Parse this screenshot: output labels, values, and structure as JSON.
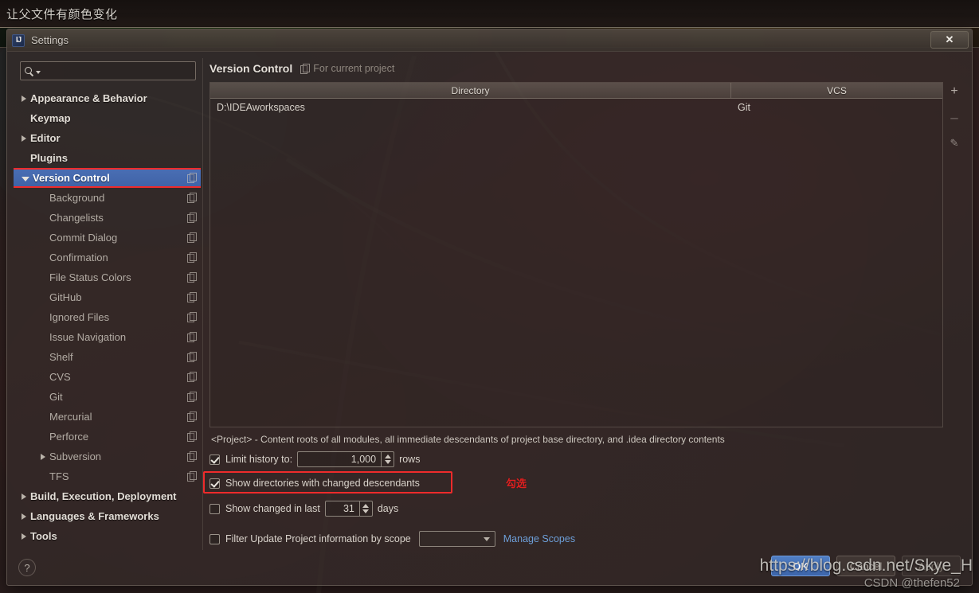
{
  "desktop": {
    "caption": "让父文件有颜色变化"
  },
  "window": {
    "title": "Settings",
    "app_icon": "intellij-idea-icon",
    "close_label": "✕"
  },
  "search": {
    "value": "",
    "placeholder": "",
    "icon": "search-icon"
  },
  "sidebar": {
    "items": [
      {
        "label": "Appearance & Behavior",
        "level": "top",
        "arrow": "collapsed",
        "copy": false,
        "selected": false
      },
      {
        "label": "Keymap",
        "level": "top",
        "arrow": "none",
        "copy": false,
        "selected": false
      },
      {
        "label": "Editor",
        "level": "top",
        "arrow": "collapsed",
        "copy": false,
        "selected": false
      },
      {
        "label": "Plugins",
        "level": "top",
        "arrow": "none",
        "copy": false,
        "selected": false
      },
      {
        "label": "Version Control",
        "level": "top",
        "arrow": "expanded",
        "copy": true,
        "selected": true
      },
      {
        "label": "Background",
        "level": "child",
        "arrow": "none",
        "copy": true,
        "selected": false
      },
      {
        "label": "Changelists",
        "level": "child",
        "arrow": "none",
        "copy": true,
        "selected": false
      },
      {
        "label": "Commit Dialog",
        "level": "child",
        "arrow": "none",
        "copy": true,
        "selected": false
      },
      {
        "label": "Confirmation",
        "level": "child",
        "arrow": "none",
        "copy": true,
        "selected": false
      },
      {
        "label": "File Status Colors",
        "level": "child",
        "arrow": "none",
        "copy": true,
        "selected": false
      },
      {
        "label": "GitHub",
        "level": "child",
        "arrow": "none",
        "copy": true,
        "selected": false
      },
      {
        "label": "Ignored Files",
        "level": "child",
        "arrow": "none",
        "copy": true,
        "selected": false
      },
      {
        "label": "Issue Navigation",
        "level": "child",
        "arrow": "none",
        "copy": true,
        "selected": false
      },
      {
        "label": "Shelf",
        "level": "child",
        "arrow": "none",
        "copy": true,
        "selected": false
      },
      {
        "label": "CVS",
        "level": "child",
        "arrow": "none",
        "copy": true,
        "selected": false
      },
      {
        "label": "Git",
        "level": "child",
        "arrow": "none",
        "copy": true,
        "selected": false
      },
      {
        "label": "Mercurial",
        "level": "child",
        "arrow": "none",
        "copy": true,
        "selected": false
      },
      {
        "label": "Perforce",
        "level": "child",
        "arrow": "none",
        "copy": true,
        "selected": false
      },
      {
        "label": "Subversion",
        "level": "child",
        "arrow": "collapsed",
        "copy": true,
        "selected": false
      },
      {
        "label": "TFS",
        "level": "child",
        "arrow": "none",
        "copy": true,
        "selected": false
      },
      {
        "label": "Build, Execution, Deployment",
        "level": "top",
        "arrow": "collapsed",
        "copy": false,
        "selected": false
      },
      {
        "label": "Languages & Frameworks",
        "level": "top",
        "arrow": "collapsed",
        "copy": false,
        "selected": false
      },
      {
        "label": "Tools",
        "level": "top",
        "arrow": "collapsed",
        "copy": false,
        "selected": false
      }
    ]
  },
  "panel": {
    "title": "Version Control",
    "scope_tag": "For current project",
    "scope_icon": "copy-icon"
  },
  "table": {
    "columns": [
      "Directory",
      "VCS"
    ],
    "rows": [
      {
        "directory": "D:\\IDEAworkspaces",
        "vcs": "Git"
      }
    ]
  },
  "toolbar": {
    "add_label": "+",
    "remove_label": "–",
    "edit_label": "✎",
    "add_icon": "plus-icon",
    "remove_icon": "minus-icon",
    "edit_icon": "pencil-icon"
  },
  "options": {
    "note": "<Project> - Content roots of all modules, all immediate descendants of project base directory, and .idea directory contents",
    "limit_history": {
      "label": "Limit history to:",
      "checked": true,
      "value": "1,000",
      "suffix": "rows"
    },
    "show_directories": {
      "label": "Show directories with changed descendants",
      "checked": true
    },
    "show_changed_last": {
      "label": "Show changed in last",
      "checked": false,
      "value": "31",
      "suffix": "days"
    },
    "filter_scope": {
      "label": "Filter Update Project information by scope",
      "checked": false,
      "combo_value": "",
      "link": "Manage Scopes"
    }
  },
  "annotation": {
    "text": "勾选",
    "color": "#e02020"
  },
  "footer": {
    "help_label": "?",
    "ok_label": "OK",
    "cancel_label": "Cancel",
    "apply_label": "Apply"
  },
  "watermarks": {
    "primary": "https://blog.csdn.net/Skye_H",
    "secondary": "CSDN @thefen52"
  }
}
